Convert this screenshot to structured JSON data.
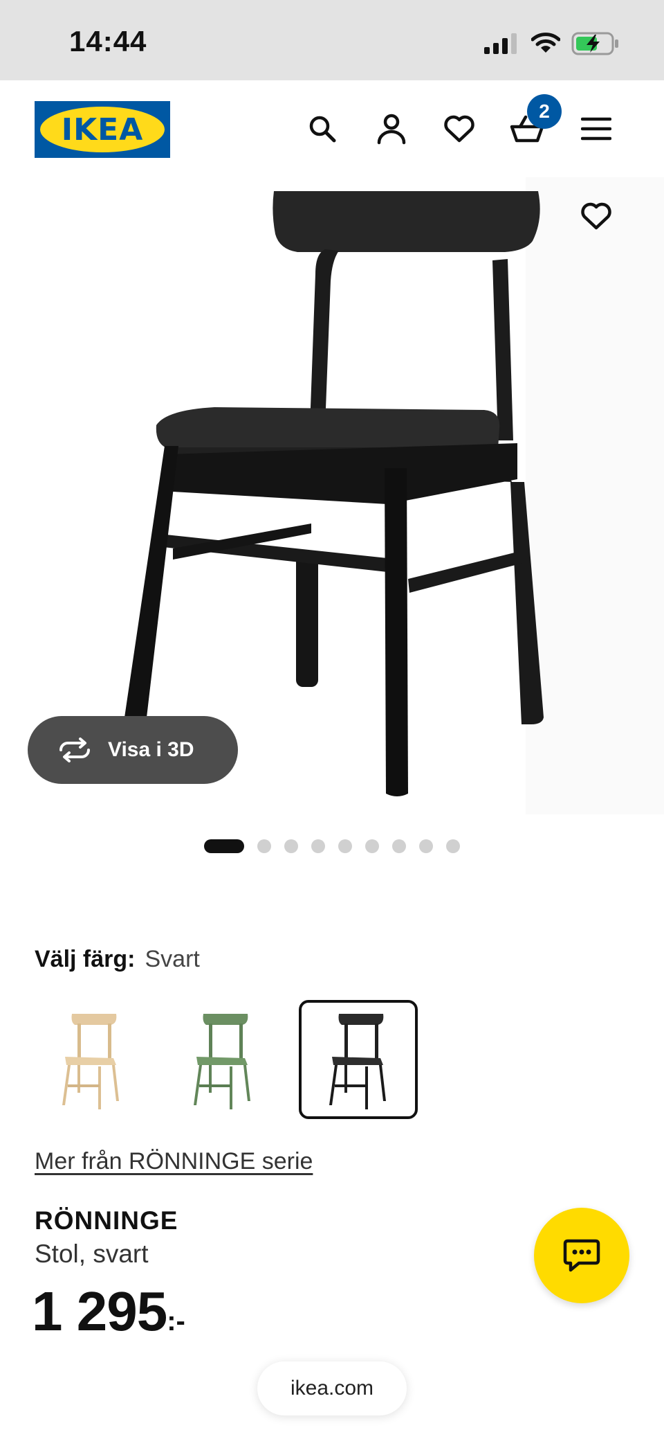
{
  "status_bar": {
    "time": "14:44"
  },
  "header": {
    "logo_text": "IKEA",
    "cart_count": "2",
    "brand_blue": "#0058a3",
    "brand_yellow": "#ffda1a",
    "icons": [
      "search-icon",
      "account-icon",
      "heart-icon",
      "cart-icon",
      "menu-icon"
    ]
  },
  "gallery": {
    "view_3d_label": "Visa i 3D",
    "dots_total": 9,
    "active_dot": 1
  },
  "color": {
    "label": "Välj färg:",
    "value": "Svart",
    "options": [
      {
        "name": "Björk",
        "color": "#e4c9a0"
      },
      {
        "name": "Grön",
        "color": "#6b8f62"
      },
      {
        "name": "Svart",
        "color": "#2a2a2a"
      }
    ]
  },
  "product": {
    "series_link": "Mer från RÖNNINGE serie",
    "name": "RÖNNINGE",
    "description": "Stol, svart",
    "price": "1 295",
    "price_suffix": ":-"
  },
  "chat": {
    "icon": "chat-icon",
    "color": "#ffdb00"
  },
  "browser": {
    "url": "ikea.com"
  }
}
